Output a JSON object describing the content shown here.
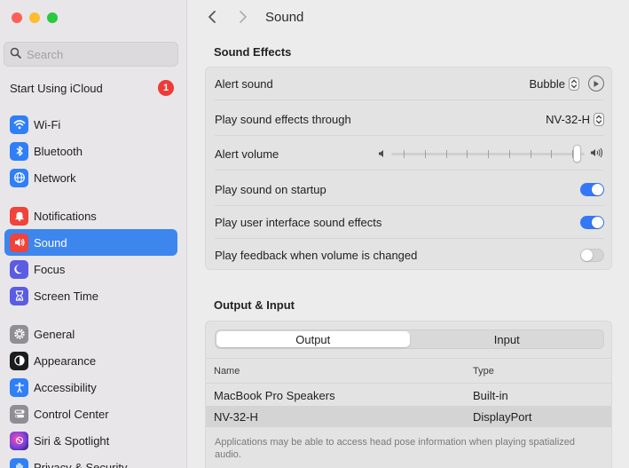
{
  "window": {
    "traffic_colors": [
      "#ff5f57",
      "#febc2e",
      "#28c840"
    ]
  },
  "sidebar": {
    "search": {
      "placeholder": "Search"
    },
    "icloud": {
      "label": "Start Using iCloud",
      "badge": "1"
    },
    "items": [
      {
        "label": "Wi-Fi",
        "icon": "wifi-icon",
        "color": "#2f7ff6",
        "selected": false
      },
      {
        "label": "Bluetooth",
        "icon": "bluetooth-icon",
        "color": "#2f7ff6",
        "selected": false
      },
      {
        "label": "Network",
        "icon": "globe-icon",
        "color": "#2f7ff6",
        "selected": false
      },
      {
        "label": "Notifications",
        "icon": "bell-icon",
        "color": "#f0433a",
        "selected": false
      },
      {
        "label": "Sound",
        "icon": "speaker-icon",
        "color": "#f0433a",
        "selected": true
      },
      {
        "label": "Focus",
        "icon": "moon-icon",
        "color": "#5b5ce2",
        "selected": false
      },
      {
        "label": "Screen Time",
        "icon": "hourglass-icon",
        "color": "#5b5ce2",
        "selected": false
      },
      {
        "label": "General",
        "icon": "gear-icon",
        "color": "#8e8e93",
        "selected": false
      },
      {
        "label": "Appearance",
        "icon": "appearance-icon",
        "color": "#1c1c1e",
        "selected": false
      },
      {
        "label": "Accessibility",
        "icon": "accessibility-icon",
        "color": "#2f7ff6",
        "selected": false
      },
      {
        "label": "Control Center",
        "icon": "control-center-icon",
        "color": "#8e8e93",
        "selected": false
      },
      {
        "label": "Siri & Spotlight",
        "icon": "siri-icon",
        "color": "#7b3fe4",
        "selected": false
      },
      {
        "label": "Privacy & Security",
        "icon": "hand-icon",
        "color": "#2f7ff6",
        "selected": false
      }
    ]
  },
  "header": {
    "title": "Sound"
  },
  "sound_effects": {
    "title": "Sound Effects",
    "alert_sound": {
      "label": "Alert sound",
      "value": "Bubble"
    },
    "play_through": {
      "label": "Play sound effects through",
      "value": "NV-32-H"
    },
    "alert_volume": {
      "label": "Alert volume",
      "level": 0.98
    },
    "startup": {
      "label": "Play sound on startup",
      "on": true
    },
    "ui_effects": {
      "label": "Play user interface sound effects",
      "on": true
    },
    "feedback": {
      "label": "Play feedback when volume is changed",
      "on": false
    }
  },
  "output_input": {
    "title": "Output & Input",
    "tabs": [
      {
        "label": "Output",
        "selected": true
      },
      {
        "label": "Input",
        "selected": false
      }
    ],
    "columns": {
      "name": "Name",
      "type": "Type"
    },
    "devices": [
      {
        "name": "MacBook Pro Speakers",
        "type": "Built-in",
        "selected": false
      },
      {
        "name": "NV-32-H",
        "type": "DisplayPort",
        "selected": true
      }
    ],
    "note": "Applications may be able to access head pose information when playing spatialized audio."
  },
  "accent_color": "#3478f6"
}
